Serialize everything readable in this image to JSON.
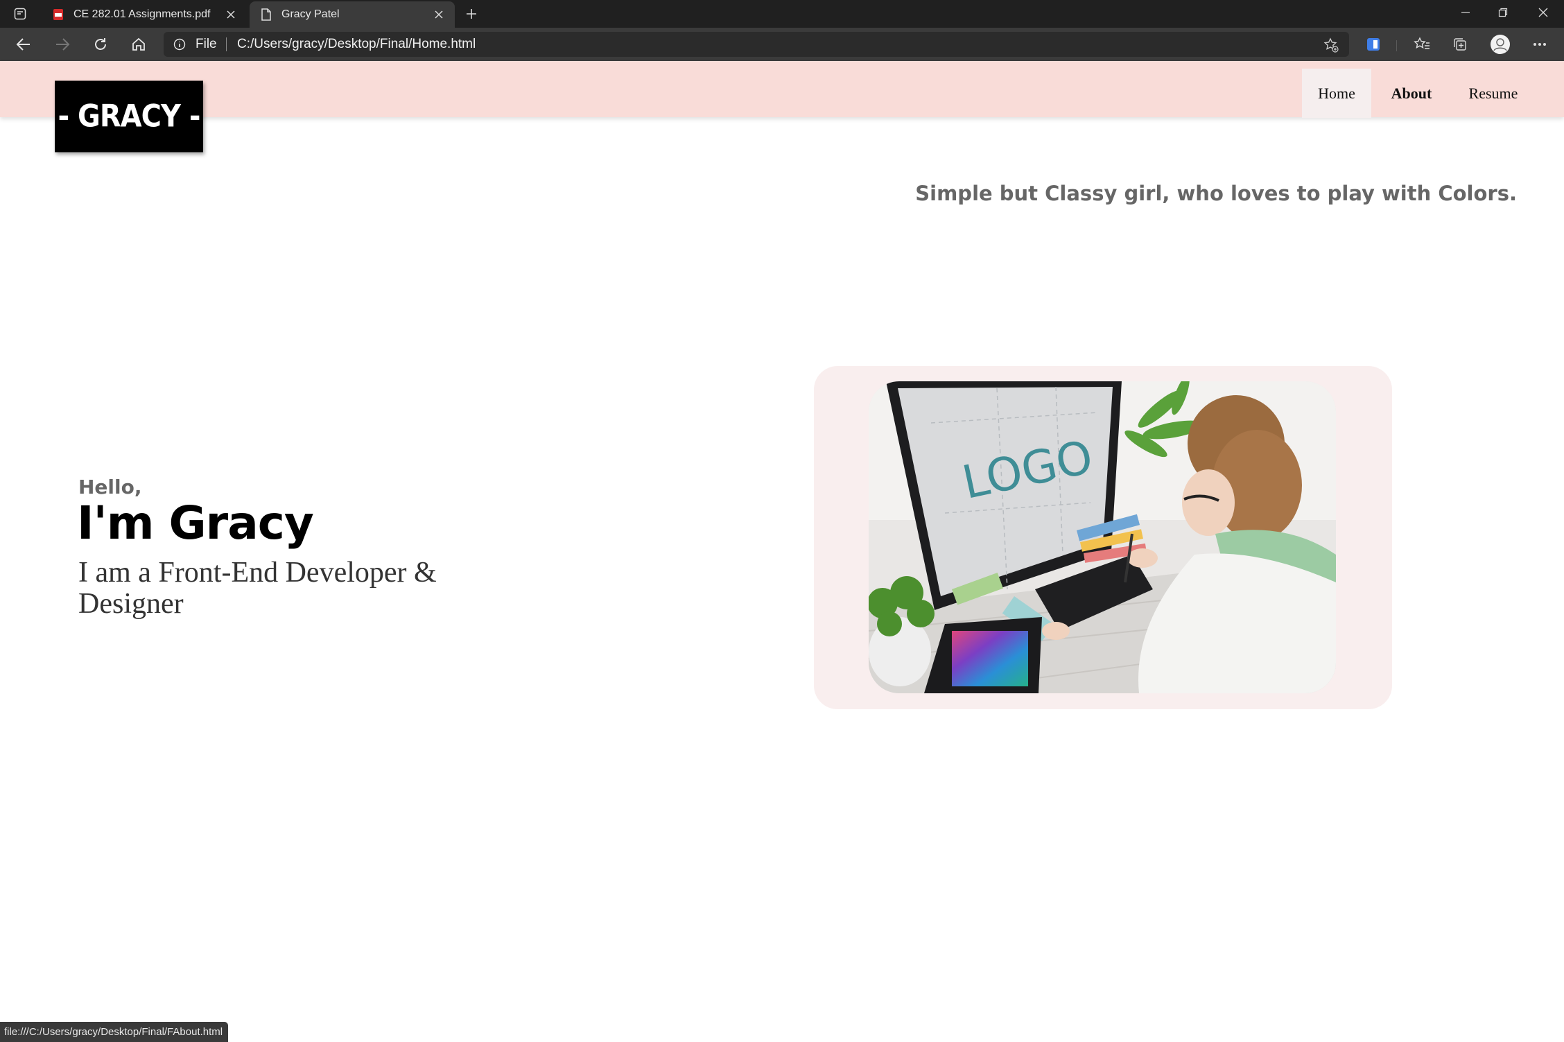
{
  "browser": {
    "tabs": [
      {
        "title": "CE 282.01 Assignments.pdf",
        "icon": "pdf-icon",
        "active": false
      },
      {
        "title": "Gracy Patel",
        "icon": "page-icon",
        "active": true
      }
    ],
    "address": {
      "scheme": "File",
      "url": "C:/Users/gracy/Desktop/Final/Home.html"
    },
    "status_url": "file:///C:/Users/gracy/Desktop/Final/FAbout.html"
  },
  "site": {
    "logo_text": "- GRACY -",
    "nav": [
      {
        "label": "Home",
        "active": true
      },
      {
        "label": "About",
        "active": false
      },
      {
        "label": "Resume",
        "active": false
      }
    ],
    "tagline": "Simple but Classy girl, who loves to play with Colors.",
    "hero": {
      "greeting": "Hello,",
      "name": "I'm Gracy",
      "role": "I am a Front-End Developer & Designer",
      "image_alt": "Designer drawing on a tablet in front of a monitor showing LOGO"
    },
    "colors": {
      "header_bg": "#f9dcd8",
      "card_bg": "#f9eeee",
      "active_nav_bg": "#f5eeee",
      "logo_bg": "#000000"
    }
  }
}
